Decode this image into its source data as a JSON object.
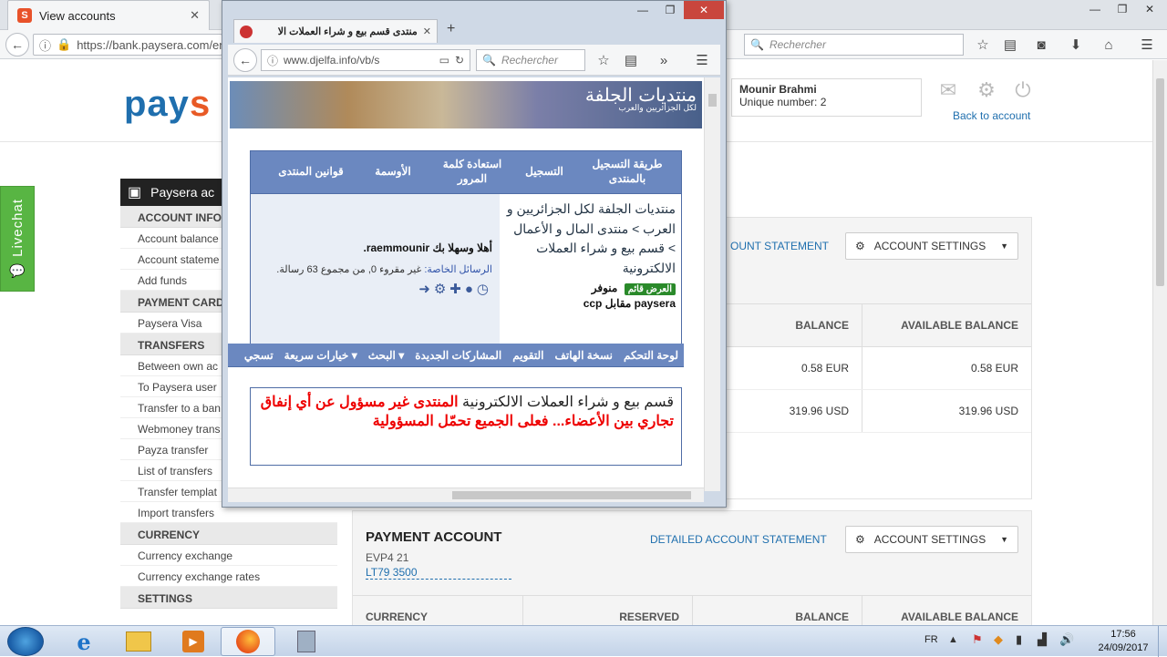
{
  "browser": {
    "tab_title": "View accounts",
    "tab_favicon": "S",
    "url": "https://bank.paysera.com/en",
    "search_placeholder": "Rechercher"
  },
  "paysera": {
    "logo_text_blue": "pay",
    "logo_text_orange": "s",
    "user_name": "Mounir Brahmi",
    "user_number": "Unique number: 2",
    "back_link": "Back to account",
    "livechat": "Livechat",
    "sidebar_title": "Paysera ac",
    "sidebar": [
      {
        "type": "sec",
        "label": "ACCOUNT INFOR"
      },
      {
        "type": "item",
        "label": "Account balance"
      },
      {
        "type": "item",
        "label": "Account stateme"
      },
      {
        "type": "item",
        "label": "Add funds"
      },
      {
        "type": "sec",
        "label": "PAYMENT CARDS"
      },
      {
        "type": "item",
        "label": "Paysera Visa"
      },
      {
        "type": "sec",
        "label": "TRANSFERS"
      },
      {
        "type": "item",
        "label": "Between own ac"
      },
      {
        "type": "item",
        "label": "To Paysera user"
      },
      {
        "type": "item",
        "label": "Transfer to a ban"
      },
      {
        "type": "item",
        "label": "Webmoney trans"
      },
      {
        "type": "item",
        "label": "Payza transfer"
      },
      {
        "type": "item",
        "label": "List of transfers"
      },
      {
        "type": "item",
        "label": "Transfer templat"
      },
      {
        "type": "item",
        "label": "Import transfers"
      },
      {
        "type": "sec",
        "label": "CURRENCY"
      },
      {
        "type": "item",
        "label": "Currency exchange"
      },
      {
        "type": "item",
        "label": "Currency exchange rates"
      },
      {
        "type": "sec",
        "label": "SETTINGS"
      }
    ],
    "account1": {
      "statement_link": "OUNT STATEMENT",
      "settings_btn": "ACCOUNT SETTINGS",
      "headers": [
        "BALANCE",
        "AVAILABLE BALANCE"
      ],
      "rows": [
        {
          "balance": "0.58 EUR",
          "available": "0.58 EUR"
        },
        {
          "balance": "319.96 USD",
          "available": "319.96 USD"
        }
      ]
    },
    "account2": {
      "title": "PAYMENT ACCOUNT",
      "evp": "EVP4 21",
      "iban": "LT79 3500",
      "statement_link": "DETAILED ACCOUNT STATEMENT",
      "settings_btn": "ACCOUNT SETTINGS",
      "headers": [
        "CURRENCY",
        "RESERVED",
        "BALANCE",
        "AVAILABLE BALANCE"
      ]
    }
  },
  "popup": {
    "tab_title": "منتدى قسم بيع و شراء العملات الا",
    "url": "www.djelfa.info/vb/s",
    "search_placeholder": "Rechercher",
    "banner_logo": "منتديات الجلفة",
    "banner_sub": "لكل الجزائريين والعرب",
    "nav_items": [
      "طريقة التسجيل بالمنتدى",
      "التسجيل",
      "استعادة كلمة المرور",
      "الأوسمة",
      "قوانين المنتدى"
    ],
    "breadcrumb": "منتديات الجلفة لكل الجزائريين و العرب > منتدى المال و الأعمال > قسم بيع و شراء العملات الالكترونية",
    "offer_badge": "العرض قائم",
    "thread_line1": "منوفر",
    "thread_line2": "paysera مقابل ccp",
    "welcome": "أهلا وسهلا بك raemmounir.",
    "pm_label": "الرسائل الخاصة:",
    "pm_text": "غير مقروء 0, من مجموع 63 رسالة.",
    "bar_items": [
      "لوحة التحكم",
      "نسخة الهاتف",
      "التقويم",
      "المشاركات الجديدة",
      "البحث ▾",
      "خيارات سريعة ▾",
      "تسجي"
    ],
    "notice_normal": "قسم بيع و شراء العملات الالكترونية",
    "notice_red": "المنتدى غير مسؤول عن أي إنفاق تجاري بين الأعضاء... فعلى الجميع تحمّل المسؤولية"
  },
  "taskbar": {
    "lang": "FR",
    "time": "17:56",
    "date": "24/09/2017"
  },
  "colors": {
    "paysera_blue": "#1f6fae",
    "paysera_orange": "#e85a26",
    "forum_blue": "#6b88c0",
    "livechat_green": "#58b543"
  }
}
